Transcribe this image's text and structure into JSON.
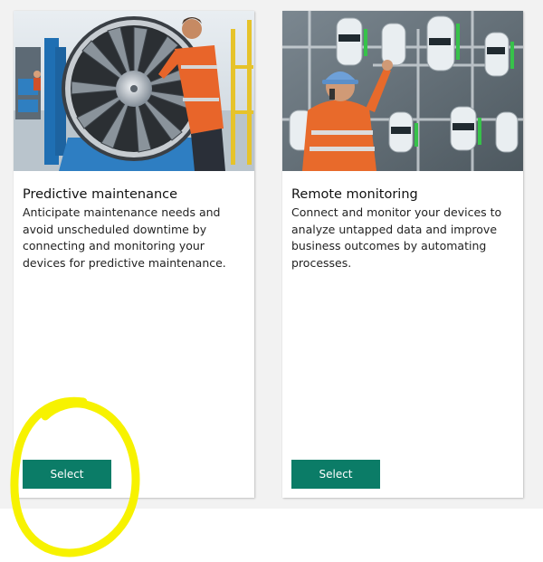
{
  "cards": [
    {
      "title": "Predictive maintenance",
      "description": "Anticipate maintenance needs and avoid unscheduled downtime by connecting and monitoring your devices for predictive maintenance.",
      "button_label": "Select",
      "image": "engineer-with-jet-engine-photo"
    },
    {
      "title": "Remote monitoring",
      "description": "Connect and monitor your devices to analyze untapped data and improve business outcomes by automating processes.",
      "button_label": "Select",
      "image": "engineer-with-monitoring-dashboard-photo"
    }
  ],
  "colors": {
    "button": "#0b7c67",
    "annotation": "#f7f200",
    "page_background": "#f2f2f2",
    "card_background": "#ffffff"
  }
}
